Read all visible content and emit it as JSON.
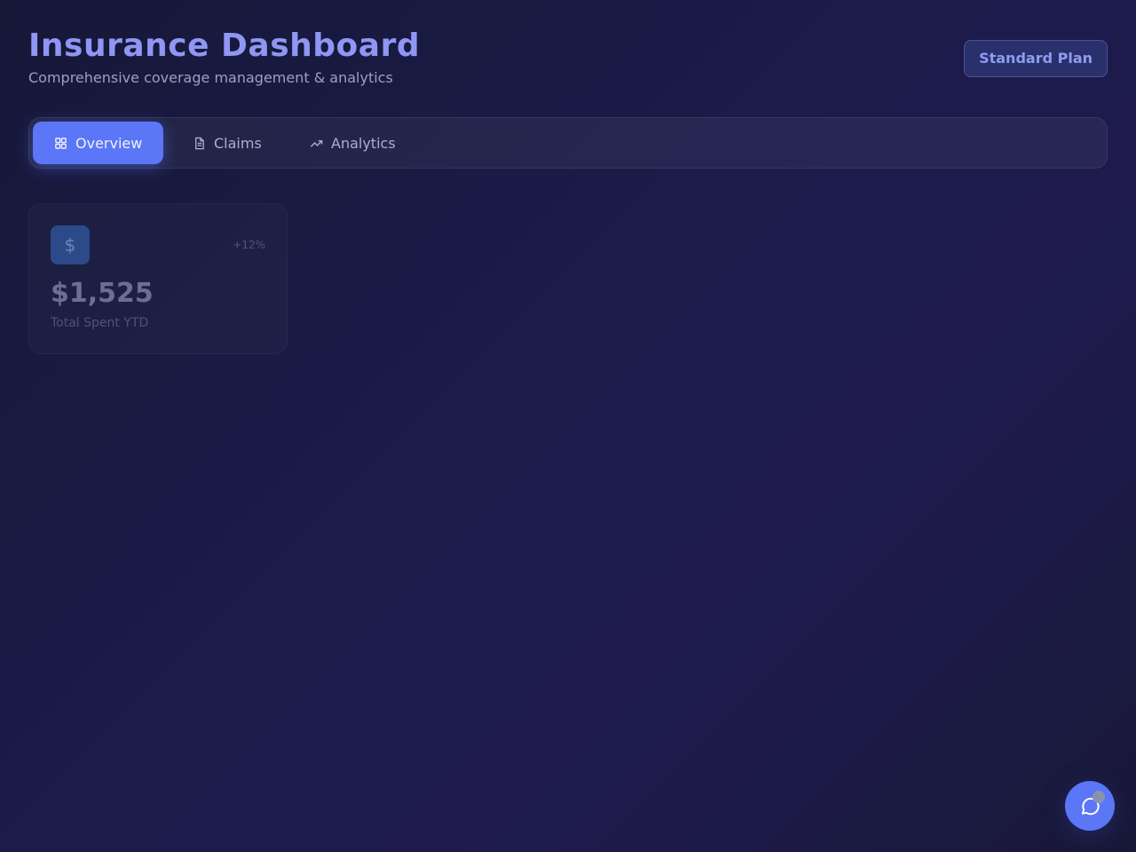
{
  "header": {
    "title": "Insurance Dashboard",
    "subtitle": "Comprehensive coverage management & analytics",
    "plan_badge": "Standard Plan"
  },
  "tabs": [
    {
      "label": "Overview",
      "icon": "grid-icon",
      "active": true
    },
    {
      "label": "Claims",
      "icon": "document-icon",
      "active": false
    },
    {
      "label": "Analytics",
      "icon": "trending-up-icon",
      "active": false
    }
  ],
  "stats": [
    {
      "icon": "dollar-icon",
      "symbol": "$",
      "change": "+12%",
      "value": "$1,525",
      "label": "Total Spent YTD"
    }
  ],
  "chat": {
    "icon": "chat-bubble-icon"
  },
  "colors": {
    "accent": "#5b76f6",
    "title": "#8f96f3",
    "background": "#1c1b4a"
  }
}
